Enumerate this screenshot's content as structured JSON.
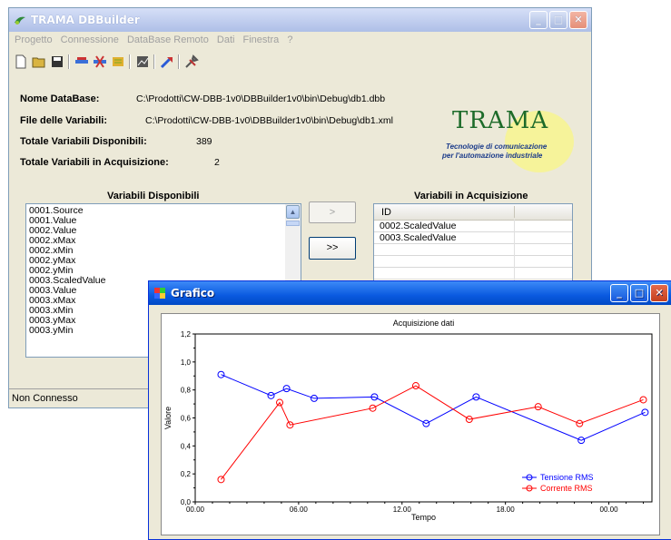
{
  "main_window": {
    "title": "TRAMA DBBuilder",
    "menu": [
      "Progetto",
      "Connessione",
      "DataBase Remoto",
      "Dati",
      "Finestra",
      "?"
    ],
    "fields": {
      "db_name_label": "Nome DataBase:",
      "db_name_value": "C:\\Prodotti\\CW-DBB-1v0\\DBBuilder1v0\\bin\\Debug\\db1.dbb",
      "vars_file_label": "File delle Variabili:",
      "vars_file_value": "C:\\Prodotti\\CW-DBB-1v0\\DBBuilder1v0\\bin\\Debug\\db1.xml",
      "total_available_label": "Totale Variabili Disponibili:",
      "total_available_value": "389",
      "total_acq_label": "Totale Variabili in Acquisizione:",
      "total_acq_value": "2"
    },
    "logo": {
      "title": "TRAMA",
      "subtitle_1": "Tecnologie di comunicazione",
      "subtitle_2": "per l'automazione industriale"
    },
    "available": {
      "header": "Variabili Disponibili",
      "items": [
        "0001.Source",
        "0001.Value",
        "0002.Value",
        "0002.xMax",
        "0002.xMin",
        "0002.yMax",
        "0002.yMin",
        "0003.ScaledValue",
        "0003.Value",
        "0003.xMax",
        "0003.xMin",
        "0003.yMax",
        "0003.yMin"
      ]
    },
    "buttons": {
      "add_one": ">",
      "add_all": ">>"
    },
    "acquisition": {
      "header": "Variabili in Acquisizione",
      "column": "ID",
      "rows": [
        "0002.ScaledValue",
        "0003.ScaledValue"
      ]
    },
    "status": "Non Connesso"
  },
  "chart_window": {
    "title": "Grafico"
  },
  "colors": {
    "tensione": "#0000ff",
    "corrente": "#ff0000",
    "logo_green": "#1d6b2a"
  },
  "chart_data": {
    "type": "line",
    "title": "Acquisizione dati",
    "xlabel": "Tempo",
    "ylabel": "Valore",
    "x_ticks": [
      "00.00",
      "06.00",
      "12.00",
      "18.00",
      "00.00"
    ],
    "x_tick_hours": [
      0,
      6,
      12,
      18,
      24
    ],
    "xlim": [
      0,
      26.5
    ],
    "ylim": [
      0,
      1.2
    ],
    "y_ticks": [
      "0,0",
      "0,2",
      "0,4",
      "0,6",
      "0,8",
      "1,0",
      "1,2"
    ],
    "y_tick_values": [
      0,
      0.2,
      0.4,
      0.6,
      0.8,
      1.0,
      1.2
    ],
    "legend_position": "bottom-right",
    "series": [
      {
        "name": "Tensione RMS",
        "color": "#0000ff",
        "x": [
          1.5,
          4.4,
          5.3,
          6.9,
          10.4,
          13.4,
          16.3,
          22.4,
          26.1
        ],
        "y": [
          0.91,
          0.76,
          0.81,
          0.74,
          0.75,
          0.56,
          0.75,
          0.44,
          0.64
        ]
      },
      {
        "name": "Corrente RMS",
        "color": "#ff0000",
        "x": [
          1.5,
          4.9,
          5.5,
          10.3,
          12.8,
          15.9,
          19.9,
          22.3,
          26.0
        ],
        "y": [
          0.16,
          0.71,
          0.55,
          0.67,
          0.83,
          0.59,
          0.68,
          0.56,
          0.73
        ]
      }
    ]
  }
}
